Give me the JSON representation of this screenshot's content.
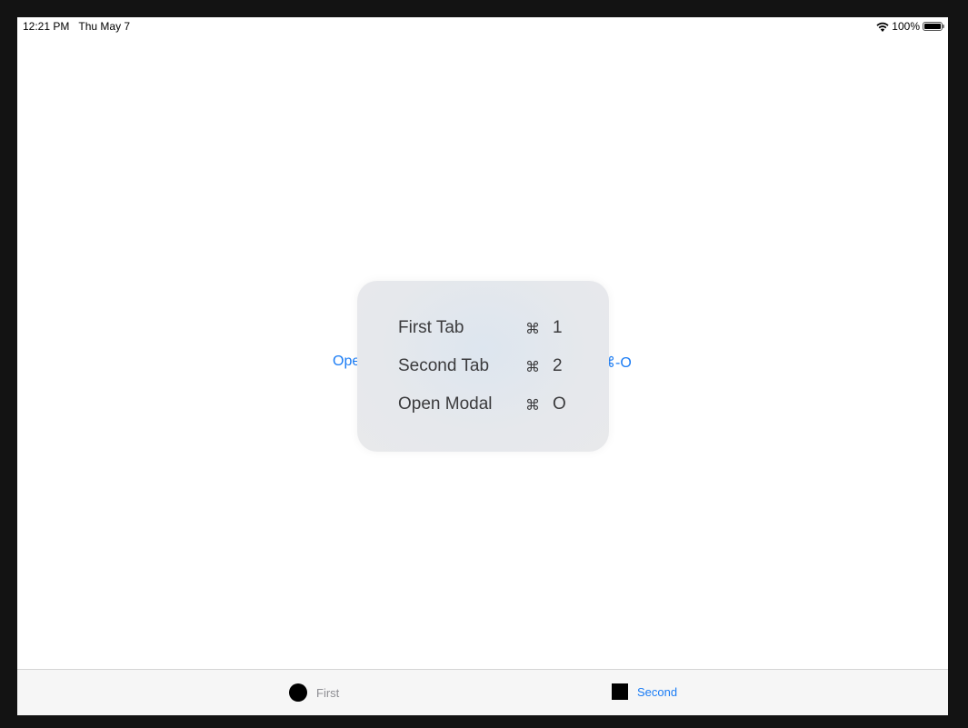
{
  "status_bar": {
    "time": "12:21 PM",
    "date": "Thu May 7",
    "battery": "100%",
    "battery_level": 1.0,
    "wifi_icon": "wifi-icon"
  },
  "background_link": {
    "left_fragment": "Ope",
    "right_fragment": "⌘-O",
    "color": "#1a7cf5"
  },
  "shortcuts_overlay": {
    "items": [
      {
        "label": "First Tab",
        "modifier": "⌘",
        "key": "1"
      },
      {
        "label": "Second Tab",
        "modifier": "⌘",
        "key": "2"
      },
      {
        "label": "Open Modal",
        "modifier": "⌘",
        "key": "O"
      }
    ]
  },
  "tab_bar": {
    "tabs": [
      {
        "label": "First",
        "icon": "circle-icon",
        "selected": false,
        "color": "#8e8e93"
      },
      {
        "label": "Second",
        "icon": "square-icon",
        "selected": true,
        "color": "#1a7cf5"
      }
    ]
  }
}
